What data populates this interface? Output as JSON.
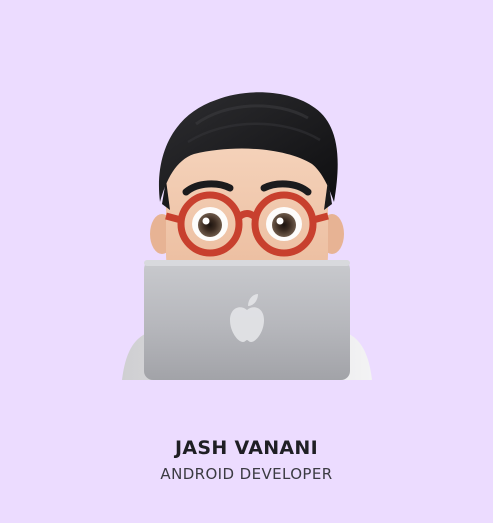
{
  "profile": {
    "name": "JASH VANANI",
    "role": "ANDROID DEVELOPER"
  },
  "theme": {
    "background": "#ecdcff",
    "glasses": "#c8402e",
    "hair": "#1c1c1e",
    "skin": "#f2c9ae",
    "laptop": "#b9babf"
  },
  "icons": {
    "avatar": "memoji-laptop-avatar",
    "logo": "apple-logo-icon"
  }
}
